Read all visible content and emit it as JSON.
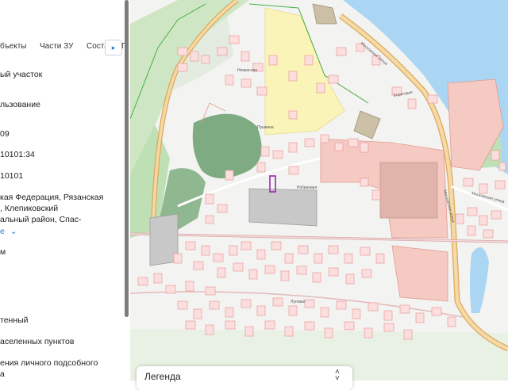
{
  "tabs": {
    "objects": "бъекты",
    "parts": "Части ЗУ",
    "composition": "Соста",
    "next_arrow": "▸",
    "cut_next": "Г"
  },
  "info": {
    "type": "ый участок",
    "use_label": "льзование",
    "number_suffix": "09",
    "cadastral": "10101:34",
    "quarter": "10101",
    "address_line1": "кая Федерация, Рязанская",
    "address_line2": ", Клепиковский",
    "address_line3": "альный район, Спас-",
    "more_link": "е",
    "more_chevron": "⌄",
    "area_unit": "м",
    "status": "тенный",
    "category": "аселенных пунктов",
    "permitted_use_line1": "ения личного подсобного",
    "permitted_use_line2": "а"
  },
  "map": {
    "street_labels": [
      "Некрасова",
      "Пушкина",
      "Рябиновая",
      "Московская улица",
      "Московская улица",
      "Московская улица",
      "Береговая",
      "Луговая"
    ]
  },
  "legend": {
    "title": "Легенда",
    "chevron_up": "˄",
    "chevron_down": "˅"
  }
}
